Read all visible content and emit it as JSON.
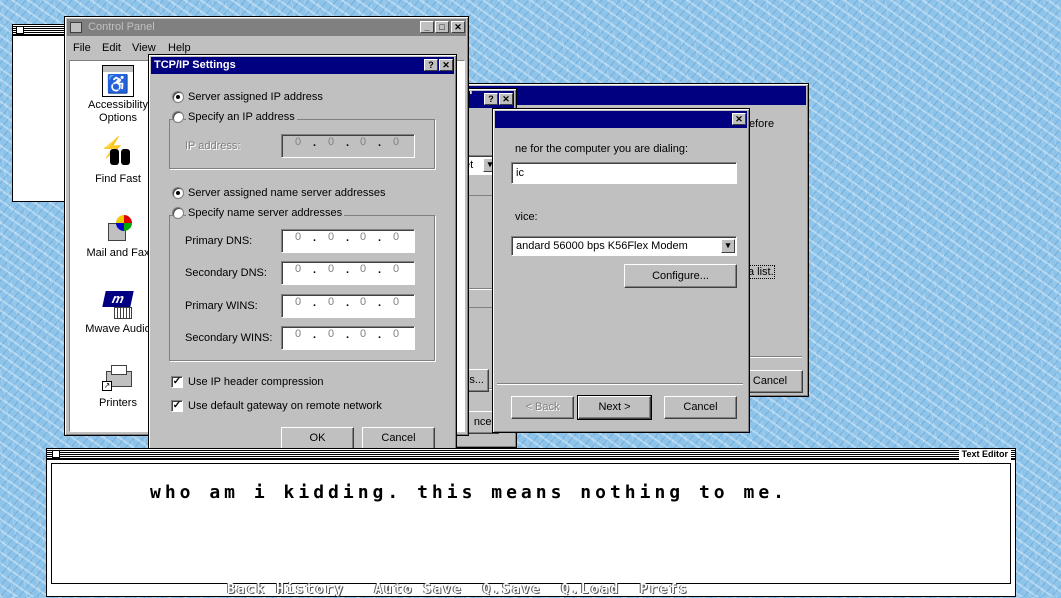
{
  "control_panel": {
    "title": "Control Panel",
    "menu": [
      "File",
      "Edit",
      "View",
      "Help"
    ],
    "icons": [
      {
        "label": "Accessibility Options",
        "icon": "wheelchair-icon"
      },
      {
        "label": "Find Fast",
        "icon": "binoculars-icon"
      },
      {
        "label": "Mail and Fax",
        "icon": "mail-fax-icon"
      },
      {
        "label": "Mwave Audio",
        "icon": "mwave-icon"
      },
      {
        "label": "Printers",
        "icon": "printer-icon"
      }
    ]
  },
  "tcpip": {
    "title": "TCP/IP Settings",
    "radio_server_ip": "Server assigned IP address",
    "radio_specify_ip": "Specify an IP address",
    "ip_address_label": "IP address:",
    "radio_server_ns": "Server assigned name server addresses",
    "radio_specify_ns": "Specify name server addresses",
    "primary_dns": "Primary DNS:",
    "secondary_dns": "Secondary DNS:",
    "primary_wins": "Primary WINS:",
    "secondary_wins": "Secondary WINS:",
    "ip_octet": "0",
    "check_ip_header": "Use IP header compression",
    "check_gateway": "Use default gateway on remote network",
    "ok": "OK",
    "cancel": "Cancel"
  },
  "middle_dialog": {
    "title_fragment": "odem",
    "dropdown_fragment": "et",
    "settings_fragment": "gs...",
    "cancel_fragment": "ncel"
  },
  "back_dialog": {
    "text_fragment": "efore",
    "link_fragment": "a list.",
    "cancel_fragment": "Cancel"
  },
  "wizard": {
    "prompt_name": "ne for the computer you are dialing:",
    "name_value": "ic",
    "prompt_device": "vice:",
    "device_value": "andard 56000 bps K56Flex Modem",
    "configure": "Configure...",
    "back": "< Back",
    "next": "Next >",
    "cancel": "Cancel"
  },
  "text_editor": {
    "title": "Text Editor",
    "content": "who am i kidding. this means nothing to me.",
    "menu": "Back History   Auto Save  Q.Save  Q.Load  Prefs"
  }
}
